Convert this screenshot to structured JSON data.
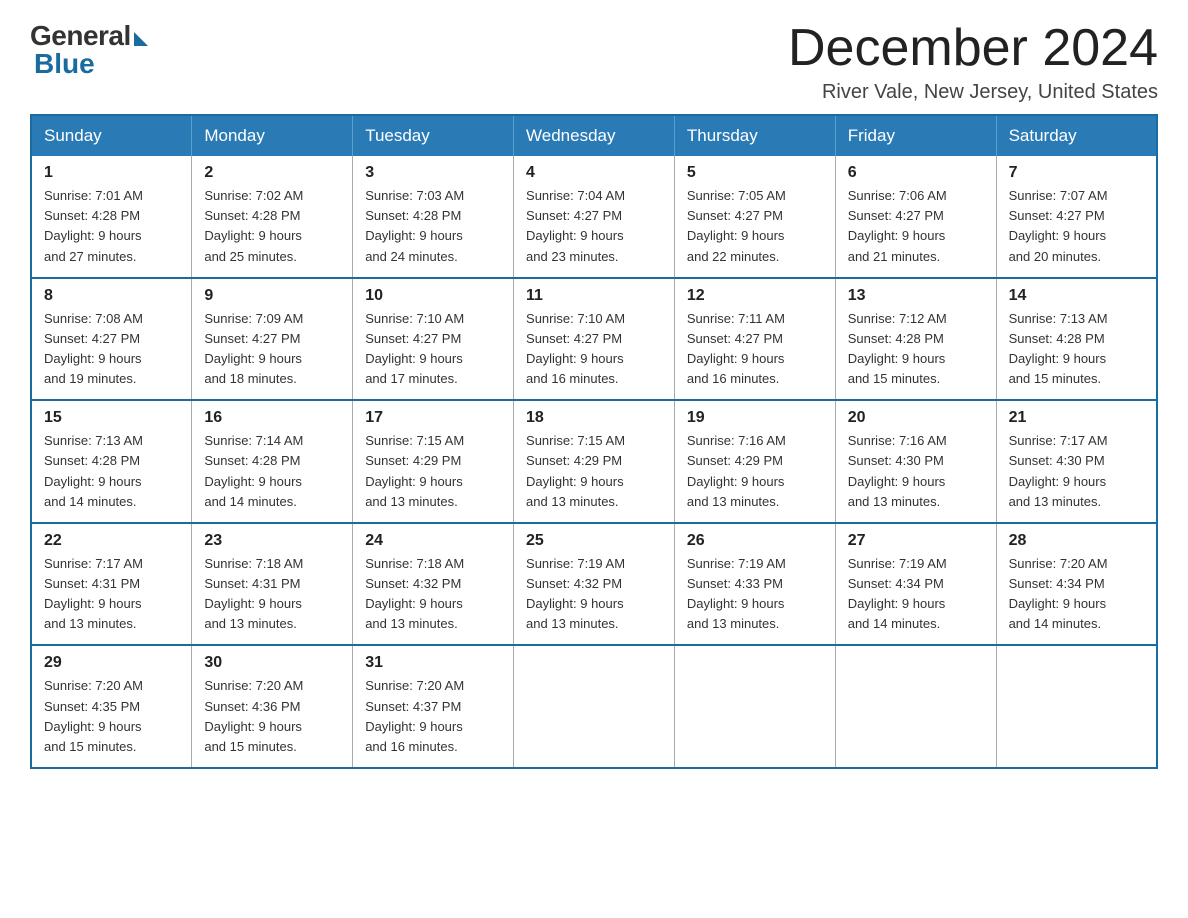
{
  "logo": {
    "general": "General",
    "blue": "Blue"
  },
  "title": {
    "month": "December 2024",
    "location": "River Vale, New Jersey, United States"
  },
  "weekdays": [
    "Sunday",
    "Monday",
    "Tuesday",
    "Wednesday",
    "Thursday",
    "Friday",
    "Saturday"
  ],
  "weeks": [
    [
      {
        "day": "1",
        "sunrise": "7:01 AM",
        "sunset": "4:28 PM",
        "daylight": "9 hours and 27 minutes."
      },
      {
        "day": "2",
        "sunrise": "7:02 AM",
        "sunset": "4:28 PM",
        "daylight": "9 hours and 25 minutes."
      },
      {
        "day": "3",
        "sunrise": "7:03 AM",
        "sunset": "4:28 PM",
        "daylight": "9 hours and 24 minutes."
      },
      {
        "day": "4",
        "sunrise": "7:04 AM",
        "sunset": "4:27 PM",
        "daylight": "9 hours and 23 minutes."
      },
      {
        "day": "5",
        "sunrise": "7:05 AM",
        "sunset": "4:27 PM",
        "daylight": "9 hours and 22 minutes."
      },
      {
        "day": "6",
        "sunrise": "7:06 AM",
        "sunset": "4:27 PM",
        "daylight": "9 hours and 21 minutes."
      },
      {
        "day": "7",
        "sunrise": "7:07 AM",
        "sunset": "4:27 PM",
        "daylight": "9 hours and 20 minutes."
      }
    ],
    [
      {
        "day": "8",
        "sunrise": "7:08 AM",
        "sunset": "4:27 PM",
        "daylight": "9 hours and 19 minutes."
      },
      {
        "day": "9",
        "sunrise": "7:09 AM",
        "sunset": "4:27 PM",
        "daylight": "9 hours and 18 minutes."
      },
      {
        "day": "10",
        "sunrise": "7:10 AM",
        "sunset": "4:27 PM",
        "daylight": "9 hours and 17 minutes."
      },
      {
        "day": "11",
        "sunrise": "7:10 AM",
        "sunset": "4:27 PM",
        "daylight": "9 hours and 16 minutes."
      },
      {
        "day": "12",
        "sunrise": "7:11 AM",
        "sunset": "4:27 PM",
        "daylight": "9 hours and 16 minutes."
      },
      {
        "day": "13",
        "sunrise": "7:12 AM",
        "sunset": "4:28 PM",
        "daylight": "9 hours and 15 minutes."
      },
      {
        "day": "14",
        "sunrise": "7:13 AM",
        "sunset": "4:28 PM",
        "daylight": "9 hours and 15 minutes."
      }
    ],
    [
      {
        "day": "15",
        "sunrise": "7:13 AM",
        "sunset": "4:28 PM",
        "daylight": "9 hours and 14 minutes."
      },
      {
        "day": "16",
        "sunrise": "7:14 AM",
        "sunset": "4:28 PM",
        "daylight": "9 hours and 14 minutes."
      },
      {
        "day": "17",
        "sunrise": "7:15 AM",
        "sunset": "4:29 PM",
        "daylight": "9 hours and 13 minutes."
      },
      {
        "day": "18",
        "sunrise": "7:15 AM",
        "sunset": "4:29 PM",
        "daylight": "9 hours and 13 minutes."
      },
      {
        "day": "19",
        "sunrise": "7:16 AM",
        "sunset": "4:29 PM",
        "daylight": "9 hours and 13 minutes."
      },
      {
        "day": "20",
        "sunrise": "7:16 AM",
        "sunset": "4:30 PM",
        "daylight": "9 hours and 13 minutes."
      },
      {
        "day": "21",
        "sunrise": "7:17 AM",
        "sunset": "4:30 PM",
        "daylight": "9 hours and 13 minutes."
      }
    ],
    [
      {
        "day": "22",
        "sunrise": "7:17 AM",
        "sunset": "4:31 PM",
        "daylight": "9 hours and 13 minutes."
      },
      {
        "day": "23",
        "sunrise": "7:18 AM",
        "sunset": "4:31 PM",
        "daylight": "9 hours and 13 minutes."
      },
      {
        "day": "24",
        "sunrise": "7:18 AM",
        "sunset": "4:32 PM",
        "daylight": "9 hours and 13 minutes."
      },
      {
        "day": "25",
        "sunrise": "7:19 AM",
        "sunset": "4:32 PM",
        "daylight": "9 hours and 13 minutes."
      },
      {
        "day": "26",
        "sunrise": "7:19 AM",
        "sunset": "4:33 PM",
        "daylight": "9 hours and 13 minutes."
      },
      {
        "day": "27",
        "sunrise": "7:19 AM",
        "sunset": "4:34 PM",
        "daylight": "9 hours and 14 minutes."
      },
      {
        "day": "28",
        "sunrise": "7:20 AM",
        "sunset": "4:34 PM",
        "daylight": "9 hours and 14 minutes."
      }
    ],
    [
      {
        "day": "29",
        "sunrise": "7:20 AM",
        "sunset": "4:35 PM",
        "daylight": "9 hours and 15 minutes."
      },
      {
        "day": "30",
        "sunrise": "7:20 AM",
        "sunset": "4:36 PM",
        "daylight": "9 hours and 15 minutes."
      },
      {
        "day": "31",
        "sunrise": "7:20 AM",
        "sunset": "4:37 PM",
        "daylight": "9 hours and 16 minutes."
      },
      null,
      null,
      null,
      null
    ]
  ],
  "labels": {
    "sunrise": "Sunrise:",
    "sunset": "Sunset:",
    "daylight": "Daylight:"
  },
  "colors": {
    "header_bg": "#2a7ab5",
    "border": "#1a6ba0"
  }
}
